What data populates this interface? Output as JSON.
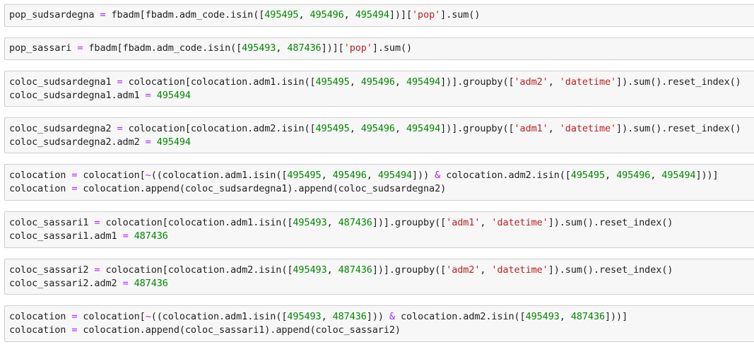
{
  "cells": [
    {
      "lines": [
        [
          [
            "n",
            "pop_sudsardegna "
          ],
          [
            "o",
            "="
          ],
          [
            "n",
            " fbadm[fbadm.adm_code.isin(["
          ],
          [
            "d",
            "495495"
          ],
          [
            "n",
            ", "
          ],
          [
            "d",
            "495496"
          ],
          [
            "n",
            ", "
          ],
          [
            "d",
            "495494"
          ],
          [
            "n",
            "])]["
          ],
          [
            "s",
            "'pop'"
          ],
          [
            "n",
            "].sum()"
          ]
        ]
      ]
    },
    {
      "lines": [
        [
          [
            "n",
            "pop_sassari "
          ],
          [
            "o",
            "="
          ],
          [
            "n",
            " fbadm[fbadm.adm_code.isin(["
          ],
          [
            "d",
            "495493"
          ],
          [
            "n",
            ", "
          ],
          [
            "d",
            "487436"
          ],
          [
            "n",
            "])]["
          ],
          [
            "s",
            "'pop'"
          ],
          [
            "n",
            "].sum()"
          ]
        ]
      ]
    },
    {
      "lines": [
        [
          [
            "n",
            "coloc_sudsardegna1 "
          ],
          [
            "o",
            "="
          ],
          [
            "n",
            " colocation[colocation.adm1.isin(["
          ],
          [
            "d",
            "495495"
          ],
          [
            "n",
            ", "
          ],
          [
            "d",
            "495496"
          ],
          [
            "n",
            ", "
          ],
          [
            "d",
            "495494"
          ],
          [
            "n",
            "])].groupby(["
          ],
          [
            "s",
            "'adm2'"
          ],
          [
            "n",
            ", "
          ],
          [
            "s",
            "'datetime'"
          ],
          [
            "n",
            "]).sum().reset_index()"
          ]
        ],
        [
          [
            "n",
            "coloc_sudsardegna1.adm1 "
          ],
          [
            "o",
            "="
          ],
          [
            "n",
            " "
          ],
          [
            "d",
            "495494"
          ]
        ]
      ]
    },
    {
      "lines": [
        [
          [
            "n",
            "coloc_sudsardegna2 "
          ],
          [
            "o",
            "="
          ],
          [
            "n",
            " colocation[colocation.adm2.isin(["
          ],
          [
            "d",
            "495495"
          ],
          [
            "n",
            ", "
          ],
          [
            "d",
            "495496"
          ],
          [
            "n",
            ", "
          ],
          [
            "d",
            "495494"
          ],
          [
            "n",
            "])].groupby(["
          ],
          [
            "s",
            "'adm1'"
          ],
          [
            "n",
            ", "
          ],
          [
            "s",
            "'datetime'"
          ],
          [
            "n",
            "]).sum().reset_index()"
          ]
        ],
        [
          [
            "n",
            "coloc_sudsardegna2.adm2 "
          ],
          [
            "o",
            "="
          ],
          [
            "n",
            " "
          ],
          [
            "d",
            "495494"
          ]
        ]
      ]
    },
    {
      "lines": [
        [
          [
            "n",
            "colocation "
          ],
          [
            "o",
            "="
          ],
          [
            "n",
            " colocation["
          ],
          [
            "o",
            "~"
          ],
          [
            "n",
            "((colocation.adm1.isin(["
          ],
          [
            "d",
            "495495"
          ],
          [
            "n",
            ", "
          ],
          [
            "d",
            "495496"
          ],
          [
            "n",
            ", "
          ],
          [
            "d",
            "495494"
          ],
          [
            "n",
            "])) "
          ],
          [
            "o",
            "&"
          ],
          [
            "n",
            " colocation.adm2.isin(["
          ],
          [
            "d",
            "495495"
          ],
          [
            "n",
            ", "
          ],
          [
            "d",
            "495496"
          ],
          [
            "n",
            ", "
          ],
          [
            "d",
            "495494"
          ],
          [
            "n",
            "]))]"
          ]
        ],
        [
          [
            "n",
            "colocation "
          ],
          [
            "o",
            "="
          ],
          [
            "n",
            " colocation.append(coloc_sudsardegna1).append(coloc_sudsardegna2)"
          ]
        ]
      ]
    },
    {
      "lines": [
        [
          [
            "n",
            "coloc_sassari1 "
          ],
          [
            "o",
            "="
          ],
          [
            "n",
            " colocation[colocation.adm1.isin(["
          ],
          [
            "d",
            "495493"
          ],
          [
            "n",
            ", "
          ],
          [
            "d",
            "487436"
          ],
          [
            "n",
            "])].groupby(["
          ],
          [
            "s",
            "'adm1'"
          ],
          [
            "n",
            ", "
          ],
          [
            "s",
            "'datetime'"
          ],
          [
            "n",
            "]).sum().reset_index()"
          ]
        ],
        [
          [
            "n",
            "coloc_sassari1.adm1 "
          ],
          [
            "o",
            "="
          ],
          [
            "n",
            " "
          ],
          [
            "d",
            "487436"
          ]
        ]
      ]
    },
    {
      "lines": [
        [
          [
            "n",
            "coloc_sassari2 "
          ],
          [
            "o",
            "="
          ],
          [
            "n",
            " colocation[colocation.adm2.isin(["
          ],
          [
            "d",
            "495493"
          ],
          [
            "n",
            ", "
          ],
          [
            "d",
            "487436"
          ],
          [
            "n",
            "])].groupby(["
          ],
          [
            "s",
            "'adm2'"
          ],
          [
            "n",
            ", "
          ],
          [
            "s",
            "'datetime'"
          ],
          [
            "n",
            "]).sum().reset_index()"
          ]
        ],
        [
          [
            "n",
            "coloc_sassari2.adm2 "
          ],
          [
            "o",
            "="
          ],
          [
            "n",
            " "
          ],
          [
            "d",
            "487436"
          ]
        ]
      ]
    },
    {
      "lines": [
        [
          [
            "n",
            "colocation "
          ],
          [
            "o",
            "="
          ],
          [
            "n",
            " colocation["
          ],
          [
            "o",
            "~"
          ],
          [
            "n",
            "((colocation.adm1.isin(["
          ],
          [
            "d",
            "495493"
          ],
          [
            "n",
            ", "
          ],
          [
            "d",
            "487436"
          ],
          [
            "n",
            "])) "
          ],
          [
            "o",
            "&"
          ],
          [
            "n",
            " colocation.adm2.isin(["
          ],
          [
            "d",
            "495493"
          ],
          [
            "n",
            ", "
          ],
          [
            "d",
            "487436"
          ],
          [
            "n",
            "]))]"
          ]
        ],
        [
          [
            "n",
            "colocation "
          ],
          [
            "o",
            "="
          ],
          [
            "n",
            " colocation.append(coloc_sassari1).append(coloc_sassari2)"
          ]
        ]
      ]
    }
  ]
}
